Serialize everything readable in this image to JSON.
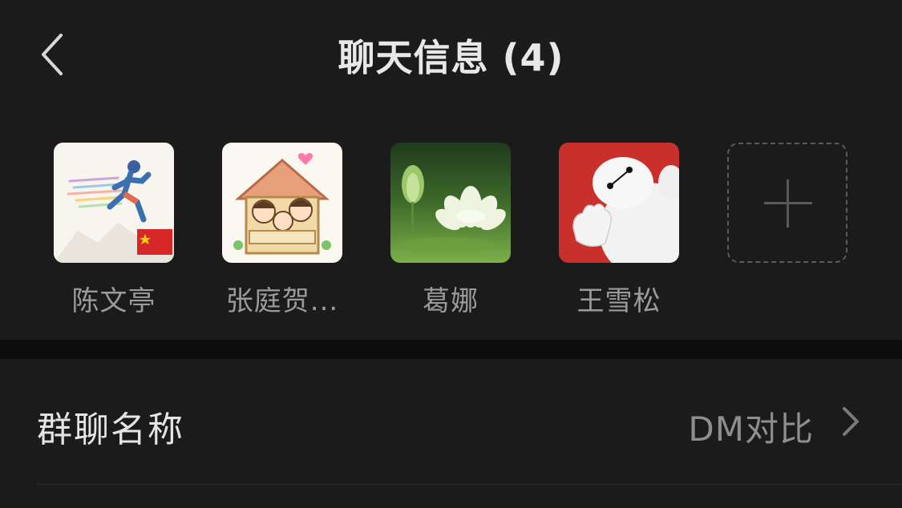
{
  "header": {
    "title": "聊天信息 (4)"
  },
  "members": [
    {
      "name": "陈文亭",
      "avatar": "runner-avatar"
    },
    {
      "name": "张庭贺...",
      "avatar": "family-house-avatar"
    },
    {
      "name": "葛娜",
      "avatar": "lotus-avatar"
    },
    {
      "name": "王雪松",
      "avatar": "baymax-avatar"
    }
  ],
  "add_member": {
    "icon": "plus-icon"
  },
  "settings": {
    "group_name_label": "群聊名称",
    "group_name_value": "DM对比"
  },
  "colors": {
    "background": "#111111",
    "panel": "#1b1b1b",
    "title_text": "#e8e8e8",
    "secondary_text": "#9b9b9b"
  }
}
